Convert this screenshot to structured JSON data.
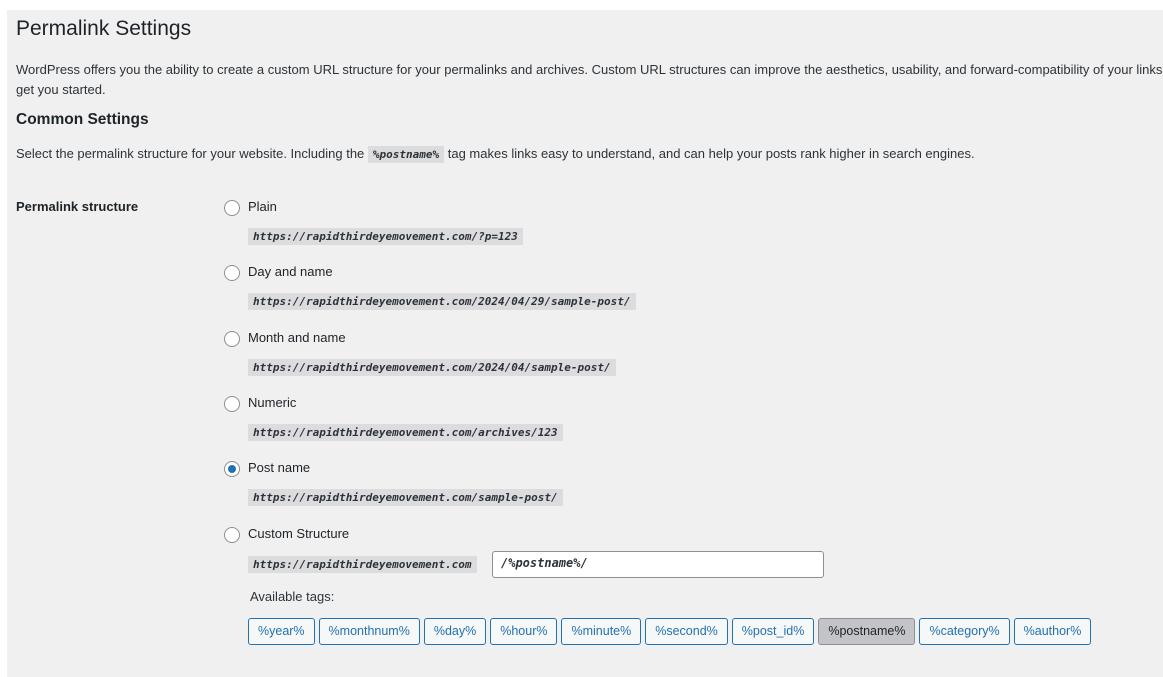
{
  "header": {
    "title": "Permalink Settings",
    "intro_line1": "WordPress offers you the ability to create a custom URL structure for your permalinks and archives. Custom URL structures can improve the aesthetics, usability, and forward-compatibility of your links",
    "intro_line2": "get you started."
  },
  "common": {
    "heading": "Common Settings",
    "note_before": "Select the permalink structure for your website. Including the ",
    "note_tag": "%postname%",
    "note_after": " tag makes links easy to understand, and can help your posts rank higher in search engines.",
    "row_label": "Permalink structure"
  },
  "options": [
    {
      "label": "Plain",
      "example": "https://rapidthirdeyemovement.com/?p=123",
      "checked": false
    },
    {
      "label": "Day and name",
      "example": "https://rapidthirdeyemovement.com/2024/04/29/sample-post/",
      "checked": false
    },
    {
      "label": "Month and name",
      "example": "https://rapidthirdeyemovement.com/2024/04/sample-post/",
      "checked": false
    },
    {
      "label": "Numeric",
      "example": "https://rapidthirdeyemovement.com/archives/123",
      "checked": false
    },
    {
      "label": "Post name",
      "example": "https://rapidthirdeyemovement.com/sample-post/",
      "checked": true
    }
  ],
  "custom": {
    "label": "Custom Structure",
    "prefix": "https://rapidthirdeyemovement.com",
    "value": "/%postname%/",
    "checked": false,
    "available_label": "Available tags:",
    "tags": [
      "%year%",
      "%monthnum%",
      "%day%",
      "%hour%",
      "%minute%",
      "%second%",
      "%post_id%",
      "%postname%",
      "%category%",
      "%author%"
    ],
    "active_tag": "%postname%"
  }
}
